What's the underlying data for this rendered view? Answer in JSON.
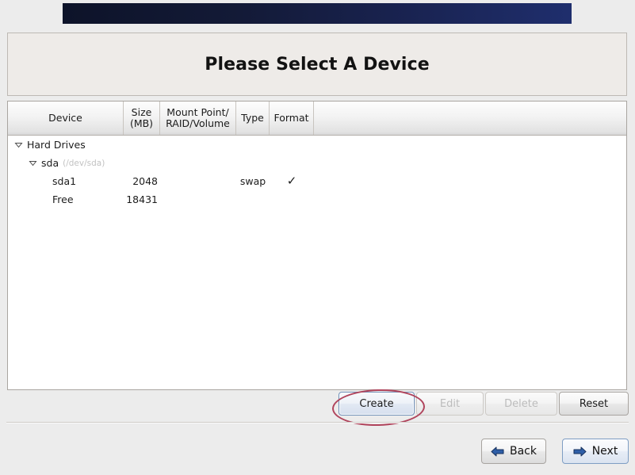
{
  "window": {
    "title": "Please Select A Device",
    "banner_color_left": "#0d1329",
    "banner_color_right": "#1f2e6d"
  },
  "table": {
    "columns": [
      {
        "label": "Device"
      },
      {
        "label": "Size\n(MB)",
        "line1": "Size",
        "line2": "(MB)"
      },
      {
        "label": "Mount Point/\nRAID/Volume",
        "line1": "Mount Point/",
        "line2": "RAID/Volume"
      },
      {
        "label": "Type"
      },
      {
        "label": "Format"
      }
    ],
    "rows": [
      {
        "device": "Hard Drives",
        "detail": "",
        "size": "",
        "mount": "",
        "type": "",
        "format": "",
        "level": 1,
        "expander": "chevron-down"
      },
      {
        "device": "sda",
        "detail": "(/dev/sda)",
        "size": "",
        "mount": "",
        "type": "",
        "format": "",
        "level": 2,
        "expander": "chevron-down"
      },
      {
        "device": "sda1",
        "detail": "",
        "size": "2048",
        "mount": "",
        "type": "swap",
        "format": "✓",
        "level": 3,
        "expander": ""
      },
      {
        "device": "Free",
        "detail": "",
        "size": "18431",
        "mount": "",
        "type": "",
        "format": "",
        "level": 3,
        "expander": ""
      }
    ]
  },
  "actions": {
    "create": "Create",
    "edit": "Edit",
    "delete": "Delete",
    "reset": "Reset",
    "create_highlighted": true,
    "edit_enabled": false,
    "delete_enabled": false,
    "highlight_color": "#b0445c"
  },
  "navigation": {
    "back": "Back",
    "next": "Next"
  }
}
